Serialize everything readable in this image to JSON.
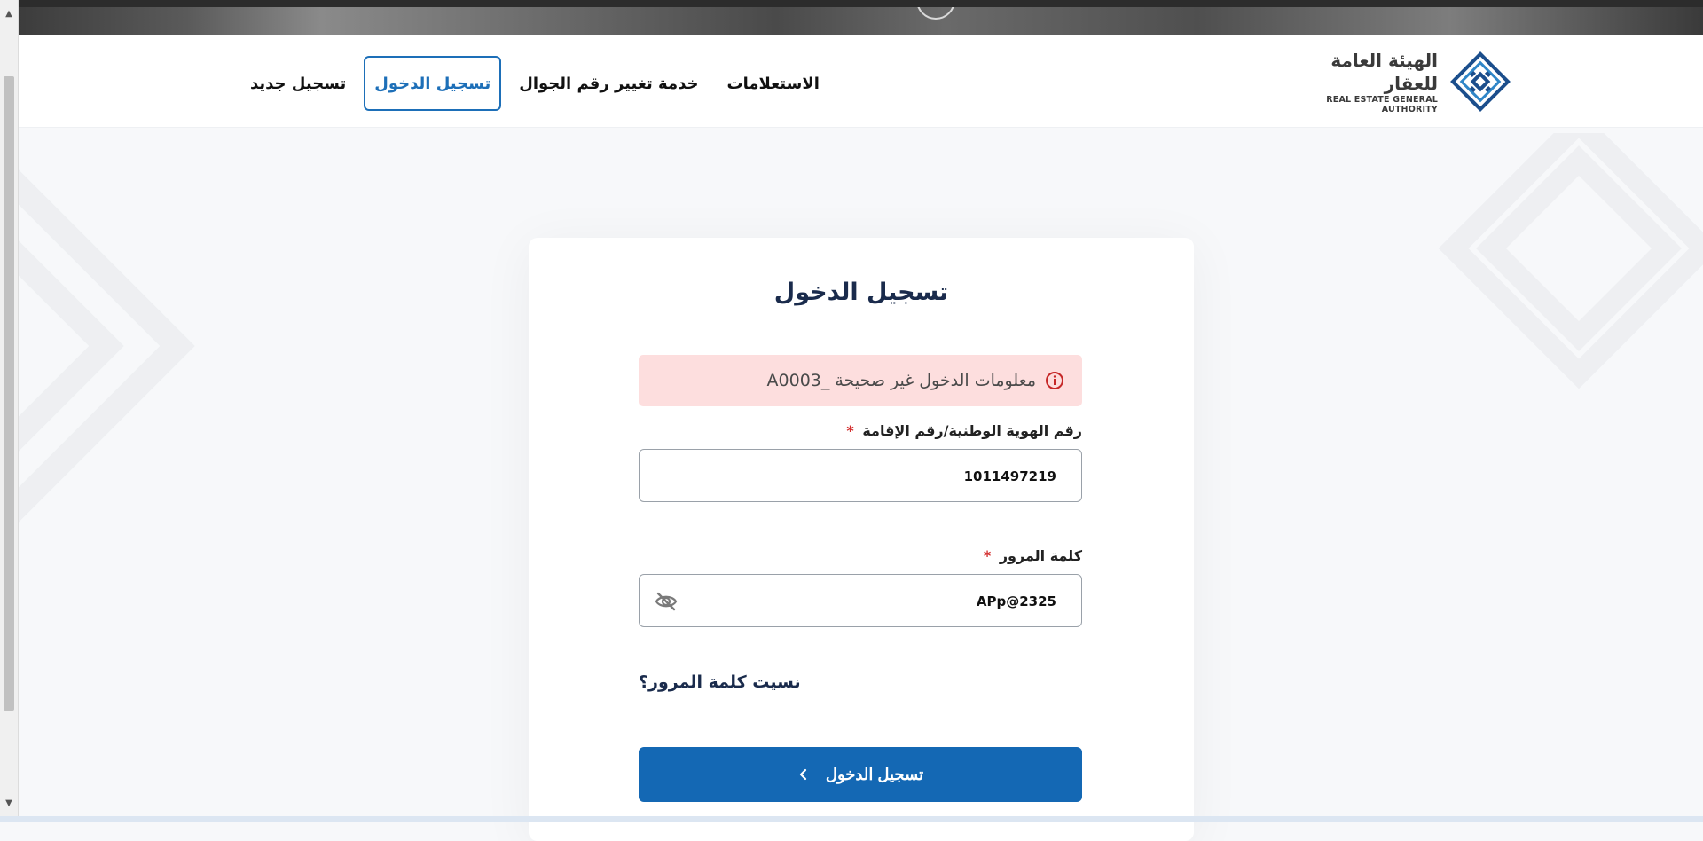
{
  "header": {
    "logo": {
      "name_ar": "الهيئة العامة للعقار",
      "name_en": "REAL ESTATE GENERAL AUTHORITY"
    },
    "nav": {
      "inquiries": "الاستعلامات",
      "change_mobile": "خدمة تغيير رقم الجوال",
      "login": "تسجيل الدخول",
      "register": "تسجيل جديد"
    }
  },
  "login_form": {
    "title": "تسجيل الدخول",
    "error_message": "معلومات الدخول غير صحيحة _A0003",
    "id_label": "رقم الهوية الوطنية/رقم الإقامة",
    "id_value": "1011497219",
    "password_label": "كلمة المرور",
    "password_value": "APp@2325",
    "required_mark": "*",
    "forgot_password": "نسيت كلمة المرور؟",
    "submit_label": "تسجيل الدخول"
  },
  "colors": {
    "primary": "#1468b4",
    "active_nav": "#1d6fb8",
    "error_bg": "#fddede",
    "error_icon": "#c62828",
    "title": "#1a2b4c"
  },
  "icons": {
    "logo": "reag-logo-icon",
    "alert": "info-circle-icon",
    "password_toggle": "eye-off-icon",
    "submit": "chevron-left-icon"
  }
}
